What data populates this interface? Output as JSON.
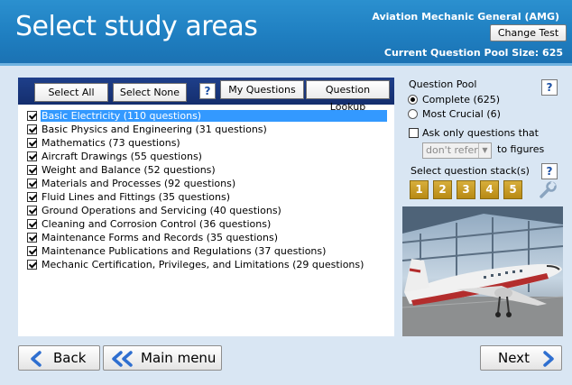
{
  "header": {
    "title": "Select study areas",
    "test_name": "Aviation Mechanic General (AMG)",
    "change_test_label": "Change Test",
    "pool_size_text": "Current Question Pool Size: 625"
  },
  "toolbar": {
    "select_all": "Select All",
    "select_none": "Select None",
    "help": "?",
    "my_questions": "My Questions",
    "question_lookup": "Question Lookup"
  },
  "topics": [
    {
      "label": "Basic Electricity (110 questions)",
      "checked": true,
      "selected": true
    },
    {
      "label": "Basic Physics and Engineering (31 questions)",
      "checked": true
    },
    {
      "label": "Mathematics (73 questions)",
      "checked": true
    },
    {
      "label": "Aircraft Drawings (55 questions)",
      "checked": true
    },
    {
      "label": "Weight and Balance (52 questions)",
      "checked": true
    },
    {
      "label": "Materials and Processes (92 questions)",
      "checked": true
    },
    {
      "label": "Fluid Lines and Fittings (35 questions)",
      "checked": true
    },
    {
      "label": "Ground Operations and Servicing (40 questions)",
      "checked": true
    },
    {
      "label": "Cleaning and Corrosion Control (36 questions)",
      "checked": true
    },
    {
      "label": "Maintenance Forms and Records (35 questions)",
      "checked": true
    },
    {
      "label": "Maintenance Publications and Regulations (37 questions)",
      "checked": true
    },
    {
      "label": "Mechanic Certification, Privileges, and Limitations (29 questions)",
      "checked": true
    }
  ],
  "question_pool": {
    "heading": "Question Pool",
    "help": "?",
    "complete_label": "Complete (625)",
    "most_crucial_label": "Most Crucial (6)",
    "selected": "complete",
    "ask_only_label": "Ask only questions that",
    "ask_only_checked": false,
    "dropdown_value": "don't refer",
    "to_figures_label": "to figures"
  },
  "stack": {
    "heading": "Select question stack(s)",
    "help": "?",
    "items": [
      "1",
      "2",
      "3",
      "4",
      "5"
    ]
  },
  "nav": {
    "back": "Back",
    "main_menu": "Main menu",
    "next": "Next"
  },
  "colors": {
    "header_blue": "#1f7fc1",
    "toolbar_navy": "#1e3f8a",
    "selection_blue": "#3399ff",
    "stack_gold": "#c99a22",
    "arrow_blue": "#2f6fd0"
  }
}
